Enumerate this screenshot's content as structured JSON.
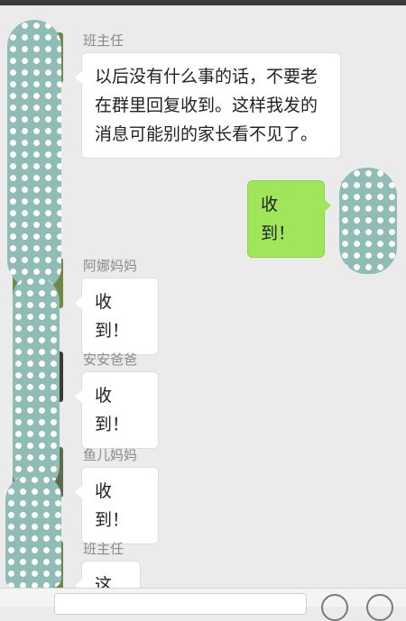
{
  "messages": [
    {
      "sender": "班主任",
      "text": "以后没有什么事的话，不要老在群里回复收到。这样我发的消息可能别的家长看不见了。"
    },
    {
      "sender": "",
      "text": "收到！"
    },
    {
      "sender": "阿娜妈妈",
      "text": "收到！"
    },
    {
      "sender": "安安爸爸",
      "text": "收到！"
    },
    {
      "sender": "鱼儿妈妈",
      "text": "收到！"
    },
    {
      "sender": "班主任",
      "text": "这..."
    }
  ],
  "colors": {
    "my_bubble": "#9fe65b",
    "scribble": "#8fbcb5"
  },
  "icons": [
    "emoji-icon",
    "plus-icon"
  ]
}
